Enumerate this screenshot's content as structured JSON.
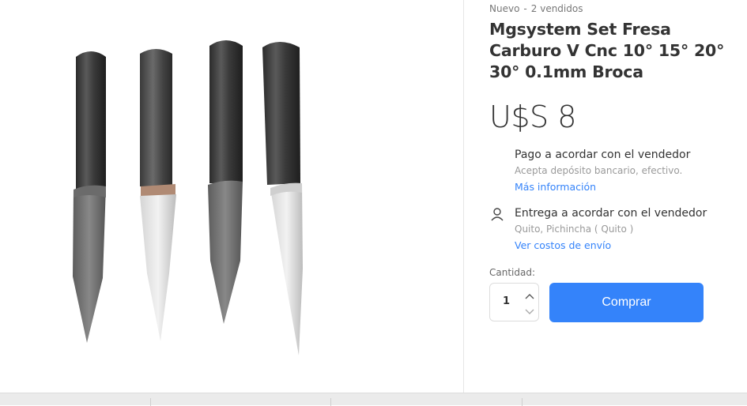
{
  "product": {
    "condition": "Nuevo",
    "separator": "-",
    "sold": "2 vendidos",
    "title": "Mgsystem Set Fresa Carburo V Cnc 10° 15° 20° 30° 0.1mm Broca",
    "price": "U$S 8",
    "image_alt": "Set de 4 fresas carburo en V"
  },
  "payment": {
    "title": "Pago a acordar con el vendedor",
    "detail": "Acepta depósito bancario, efectivo.",
    "link": "Más información",
    "icon": "payment-icon"
  },
  "shipping": {
    "title": "Entrega a acordar con el vendedor",
    "location": "Quito, Pichincha ( Quito )",
    "link": "Ver costos de envío",
    "icon": "person-icon"
  },
  "quantity": {
    "label": "Cantidad:",
    "value": "1"
  },
  "buy_button": {
    "label": "Comprar"
  },
  "colors": {
    "accent": "#3483fa",
    "text": "#333333",
    "muted": "#999999"
  }
}
